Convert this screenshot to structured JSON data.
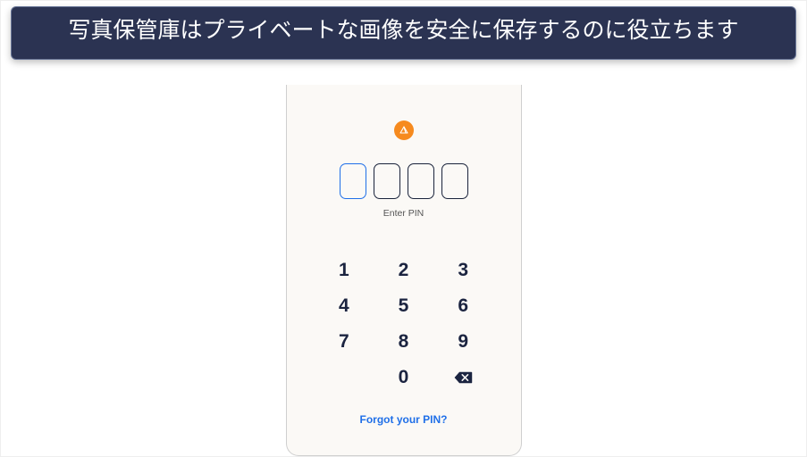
{
  "banner": {
    "text": "写真保管庫はプライベートな画像を安全に保存するのに役立ちます"
  },
  "phone": {
    "logo_name": "app-logo-icon",
    "enter_pin_label": "Enter PIN",
    "pin_length": 4,
    "active_index": 0,
    "keypad": {
      "k1": "1",
      "k2": "2",
      "k3": "3",
      "k4": "4",
      "k5": "5",
      "k6": "6",
      "k7": "7",
      "k8": "8",
      "k9": "9",
      "k0": "0"
    },
    "forgot_label": "Forgot your PIN?"
  },
  "colors": {
    "banner_bg": "#2b3352",
    "accent_orange": "#f68a1e",
    "accent_blue": "#1f6fe8",
    "dark_text": "#1b2440"
  }
}
